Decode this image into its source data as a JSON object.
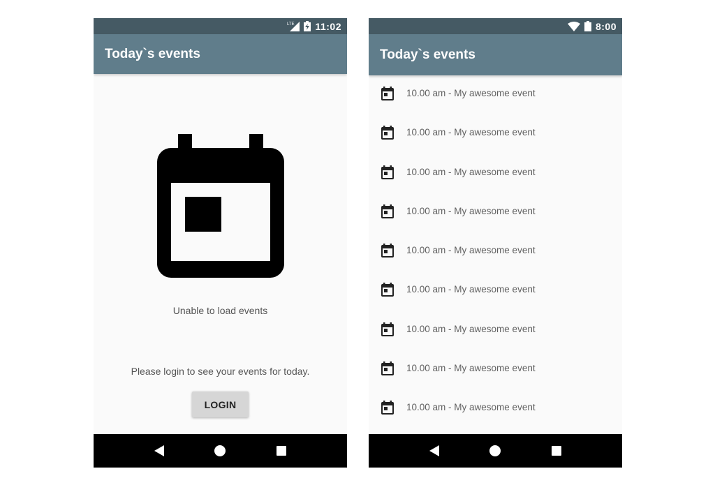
{
  "colors": {
    "status_bar": "#455a64",
    "app_bar": "#607d8b",
    "background": "#fafafa",
    "nav_bar": "#000000",
    "button": "#d6d6d6"
  },
  "left_screen": {
    "status": {
      "network_icon": "lte-signal-icon",
      "network_label": "LTE",
      "battery_icon": "battery-charging-icon",
      "time": "11:02"
    },
    "title": "Today`s events",
    "empty_icon": "calendar-icon",
    "empty_message": "Unable to load events",
    "login_message": "Please login to see your events for today.",
    "login_button": "LOGIN",
    "nav": [
      "back-icon",
      "home-icon",
      "recents-icon"
    ]
  },
  "right_screen": {
    "status": {
      "wifi_icon": "wifi-icon",
      "battery_icon": "battery-icon",
      "time": "8:00"
    },
    "title": "Today`s events",
    "events": [
      {
        "icon": "calendar-icon",
        "text": "10.00 am - My awesome event"
      },
      {
        "icon": "calendar-icon",
        "text": "10.00 am - My awesome event"
      },
      {
        "icon": "calendar-icon",
        "text": "10.00 am - My awesome event"
      },
      {
        "icon": "calendar-icon",
        "text": "10.00 am - My awesome event"
      },
      {
        "icon": "calendar-icon",
        "text": "10.00 am - My awesome event"
      },
      {
        "icon": "calendar-icon",
        "text": "10.00 am - My awesome event"
      },
      {
        "icon": "calendar-icon",
        "text": "10.00 am - My awesome event"
      },
      {
        "icon": "calendar-icon",
        "text": "10.00 am - My awesome event"
      },
      {
        "icon": "calendar-icon",
        "text": "10.00 am - My awesome event"
      }
    ],
    "nav": [
      "back-icon",
      "home-icon",
      "recents-icon"
    ]
  }
}
